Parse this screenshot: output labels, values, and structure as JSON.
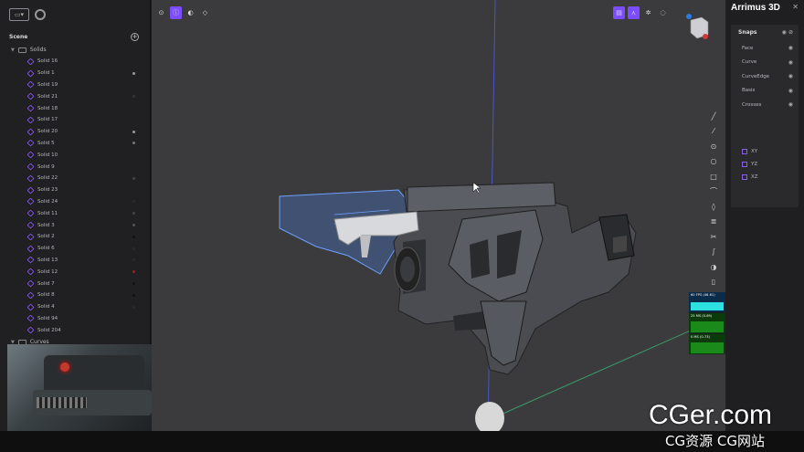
{
  "left_panel": {
    "scene_title": "Scene",
    "solids_group": "Solids",
    "curves_group": "Curves",
    "solids": [
      {
        "label": "Solid 16",
        "dot": ""
      },
      {
        "label": "Solid 1",
        "dot": "#9a9aa0"
      },
      {
        "label": "Solid 19",
        "dot": ""
      },
      {
        "label": "Solid 21",
        "dot": "#333"
      },
      {
        "label": "Solid 18",
        "dot": ""
      },
      {
        "label": "Solid 17",
        "dot": ""
      },
      {
        "label": "Solid 20",
        "dot": "#9a9aa0"
      },
      {
        "label": "Solid 5",
        "dot": "#777"
      },
      {
        "label": "Solid 10",
        "dot": ""
      },
      {
        "label": "Solid 9",
        "dot": ""
      },
      {
        "label": "Solid 22",
        "dot": "#444"
      },
      {
        "label": "Solid 23",
        "dot": ""
      },
      {
        "label": "Solid 24",
        "dot": "#2a2a2a"
      },
      {
        "label": "Solid 11",
        "dot": "#444"
      },
      {
        "label": "Solid 3",
        "dot": "#555"
      },
      {
        "label": "Solid 2",
        "dot": "#111"
      },
      {
        "label": "Solid 6",
        "dot": "#2a2a2a"
      },
      {
        "label": "Solid 13",
        "dot": "#2a2a2a"
      },
      {
        "label": "Solid 12",
        "dot": "#b01818"
      },
      {
        "label": "Solid 7",
        "dot": "#111"
      },
      {
        "label": "Solid 8",
        "dot": "#111"
      },
      {
        "label": "Solid 4",
        "dot": "#2a2a2a"
      },
      {
        "label": "Solid 94",
        "dot": ""
      },
      {
        "label": "Solid 204",
        "dot": ""
      }
    ]
  },
  "viewport": {
    "stats": {
      "fps": "60 FPS (46-61)",
      "ms1": "25 MS (0-69)",
      "ms2": "0 MS (0-73)"
    }
  },
  "right_panel": {
    "brand": "Arrimus 3D",
    "snaps_title": "Snaps",
    "snaps": [
      "Face",
      "Curve",
      "CurveEdge",
      "Basis",
      "Crosses"
    ],
    "planes": [
      "XY",
      "YZ",
      "XZ"
    ]
  },
  "watermark": {
    "main": "CGer.com",
    "sub": "CG资源 CG网站"
  },
  "colors": {
    "accent": "#7c4dff",
    "selection": "#4a7bd4"
  }
}
